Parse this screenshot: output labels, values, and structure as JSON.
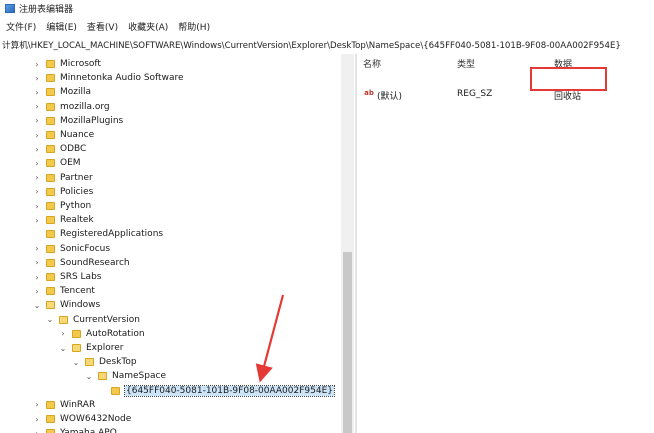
{
  "window": {
    "title": "注册表编辑器"
  },
  "menu": [
    "文件(F)",
    "编辑(E)",
    "查看(V)",
    "收藏夹(A)",
    "帮助(H)"
  ],
  "address": "计算机\\HKEY_LOCAL_MACHINE\\SOFTWARE\\Windows\\CurrentVersion\\Explorer\\DeskTop\\NameSpace\\{645FF040-5081-101B-9F08-00AA002F954E}",
  "tree": [
    {
      "label": "Microsoft",
      "expander": "›"
    },
    {
      "label": "Minnetonka Audio Software",
      "expander": "›"
    },
    {
      "label": "Mozilla",
      "expander": "›"
    },
    {
      "label": "mozilla.org",
      "expander": "›"
    },
    {
      "label": "MozillaPlugins",
      "expander": "›"
    },
    {
      "label": "Nuance",
      "expander": "›"
    },
    {
      "label": "ODBC",
      "expander": "›"
    },
    {
      "label": "OEM",
      "expander": "›"
    },
    {
      "label": "Partner",
      "expander": "›"
    },
    {
      "label": "Policies",
      "expander": "›"
    },
    {
      "label": "Python",
      "expander": "›"
    },
    {
      "label": "Realtek",
      "expander": "›"
    },
    {
      "label": "RegisteredApplications",
      "expander": ""
    },
    {
      "label": "SonicFocus",
      "expander": "›"
    },
    {
      "label": "SoundResearch",
      "expander": "›"
    },
    {
      "label": "SRS Labs",
      "expander": "›"
    },
    {
      "label": "Tencent",
      "expander": "›"
    },
    {
      "label": "Windows",
      "expander": "⌄"
    },
    {
      "label": "CurrentVersion",
      "expander": "⌄"
    },
    {
      "label": "AutoRotation",
      "expander": "›"
    },
    {
      "label": "Explorer",
      "expander": "⌄"
    },
    {
      "label": "DeskTop",
      "expander": "⌄"
    },
    {
      "label": "NameSpace",
      "expander": "⌄"
    },
    {
      "label": "{645FF040-5081-101B-9F08-00AA002F954E}",
      "expander": ""
    },
    {
      "label": "WinRAR",
      "expander": "›"
    },
    {
      "label": "WOW6432Node",
      "expander": "›"
    },
    {
      "label": "Yamaha APO",
      "expander": "›"
    }
  ],
  "list": {
    "columns": {
      "name": "名称",
      "type": "类型",
      "data": "数据"
    },
    "rows": [
      {
        "icon": "ab",
        "name": "(默认)",
        "type": "REG_SZ",
        "data": "回收站"
      }
    ]
  }
}
